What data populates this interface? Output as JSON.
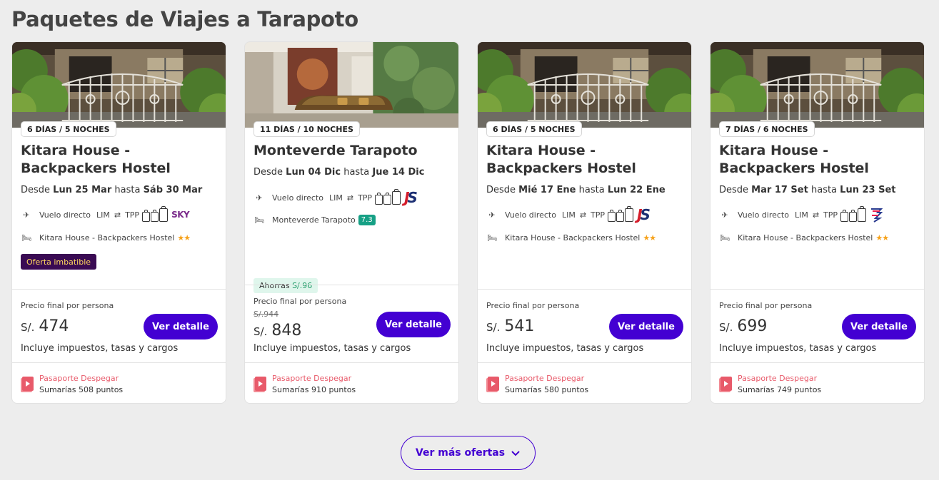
{
  "section": {
    "title": "Paquetes de Viajes a Tarapoto",
    "more_button": "Ver más ofertas"
  },
  "colors": {
    "primary": "#4300d2",
    "promo_bg": "#3a0b53",
    "promo_text": "#ffd75e",
    "passport": "#e85a6a",
    "stars": "#f6a21b",
    "rating": "#16a085"
  },
  "cards": [
    {
      "duration": "6 DÍAS / 5 NOCHES",
      "hotel": "Kitara House - Backpackers Hostel",
      "dates": {
        "prefix": "Desde",
        "from": "Lun 25 Mar",
        "middle": "hasta",
        "to": "Sáb 30 Mar"
      },
      "flight": {
        "label": "Vuelo directo",
        "origin": "LIM",
        "destination": "TPP",
        "airline": "SKY"
      },
      "lodging": {
        "name": "Kitara House - Backpackers Hostel",
        "stars": "★★"
      },
      "promo": "Oferta imbatible",
      "price_label": "Precio final por persona",
      "currency": "S/.",
      "price": "474",
      "button": "Ver detalle",
      "taxes": "Incluye impuestos, tasas y cargos",
      "passport": {
        "name": "Pasaporte Despegar",
        "points": "Sumarías 508 puntos"
      }
    },
    {
      "duration": "11 DÍAS / 10 NOCHES",
      "hotel": "Monteverde Tarapoto",
      "dates": {
        "prefix": "Desde",
        "from": "Lun 04 Dic",
        "middle": "hasta",
        "to": "Jue 14 Dic"
      },
      "flight": {
        "label": "Vuelo directo",
        "origin": "LIM",
        "destination": "TPP",
        "airline": "JetSMART"
      },
      "lodging": {
        "name": "Monteverde Tarapoto",
        "rating": "7.3"
      },
      "savings": {
        "label": "Ahorras",
        "amount": "S/.96"
      },
      "price_label": "Precio final por persona",
      "old_price": "S/.944",
      "currency": "S/.",
      "price": "848",
      "button": "Ver detalle",
      "taxes": "Incluye impuestos, tasas y cargos",
      "passport": {
        "name": "Pasaporte Despegar",
        "points": "Sumarías 910 puntos"
      }
    },
    {
      "duration": "6 DÍAS / 5 NOCHES",
      "hotel": "Kitara House - Backpackers Hostel",
      "dates": {
        "prefix": "Desde",
        "from": "Mié 17 Ene",
        "middle": "hasta",
        "to": "Lun 22 Ene"
      },
      "flight": {
        "label": "Vuelo directo",
        "origin": "LIM",
        "destination": "TPP",
        "airline": "JetSMART"
      },
      "lodging": {
        "name": "Kitara House - Backpackers Hostel",
        "stars": "★★"
      },
      "price_label": "Precio final por persona",
      "currency": "S/.",
      "price": "541",
      "button": "Ver detalle",
      "taxes": "Incluye impuestos, tasas y cargos",
      "passport": {
        "name": "Pasaporte Despegar",
        "points": "Sumarías 580 puntos"
      }
    },
    {
      "duration": "7 DÍAS / 6 NOCHES",
      "hotel": "Kitara House - Backpackers Hostel",
      "dates": {
        "prefix": "Desde",
        "from": "Mar 17 Set",
        "middle": "hasta",
        "to": "Lun 23 Set"
      },
      "flight": {
        "label": "Vuelo directo",
        "origin": "LIM",
        "destination": "TPP",
        "airline": "LATAM"
      },
      "lodging": {
        "name": "Kitara House - Backpackers Hostel",
        "stars": "★★"
      },
      "price_label": "Precio final por persona",
      "currency": "S/.",
      "price": "699",
      "button": "Ver detalle",
      "taxes": "Incluye impuestos, tasas y cargos",
      "passport": {
        "name": "Pasaporte Despegar",
        "points": "Sumarías 749 puntos"
      }
    }
  ]
}
